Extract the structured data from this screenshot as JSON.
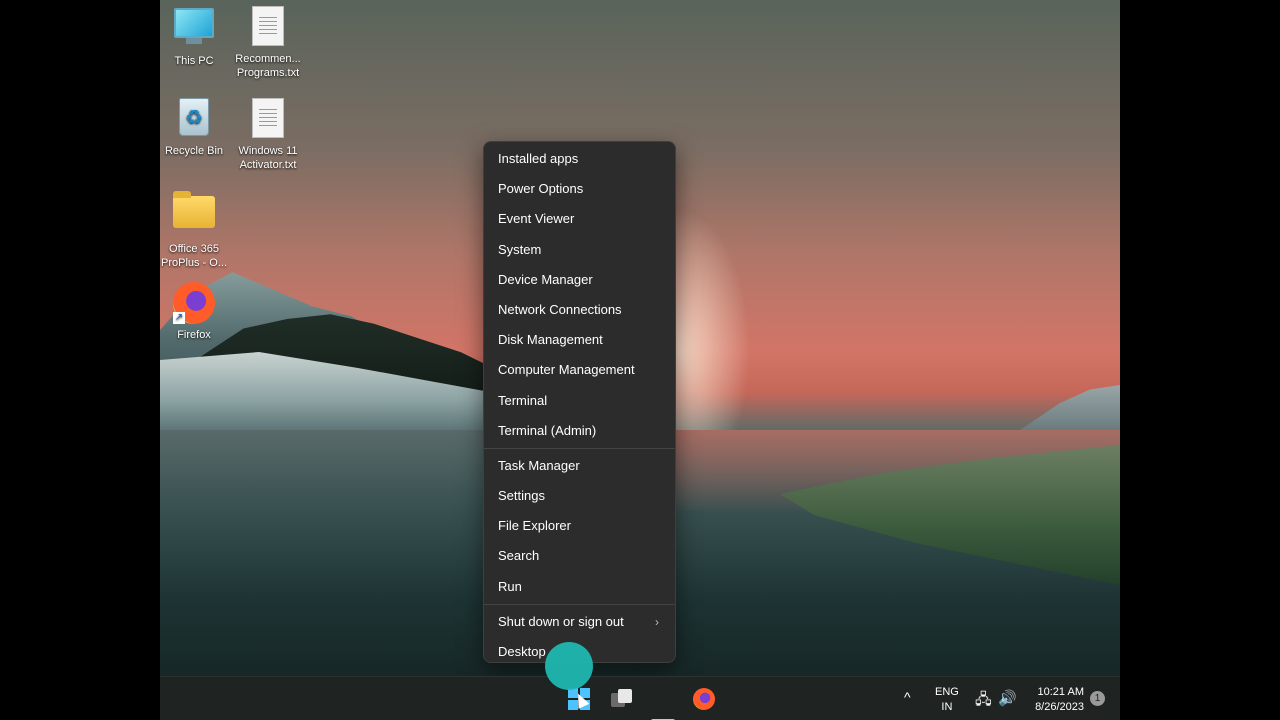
{
  "desktop": {
    "icons": [
      {
        "label": "This PC",
        "icon": "computer-icon"
      },
      {
        "label": "Recommen... Programs.txt",
        "icon": "text-file-icon"
      },
      {
        "label": "Recycle Bin",
        "icon": "recycle-bin-icon"
      },
      {
        "label": "Windows 11 Activator.txt",
        "icon": "text-file-icon"
      },
      {
        "label": "Office 365 ProPlus - O...",
        "icon": "folder-icon"
      },
      {
        "label": "Firefox",
        "icon": "firefox-icon"
      }
    ]
  },
  "context_menu": {
    "group1": [
      "Installed apps",
      "Power Options",
      "Event Viewer",
      "System",
      "Device Manager",
      "Network Connections",
      "Disk Management",
      "Computer Management",
      "Terminal",
      "Terminal (Admin)"
    ],
    "group2": [
      "Task Manager",
      "Settings",
      "File Explorer",
      "Search",
      "Run"
    ],
    "group3": [
      "Shut down or sign out",
      "Desktop"
    ],
    "submenu_glyph": "›"
  },
  "taskbar": {
    "pinned": [
      "start-icon",
      "task-view-icon",
      "file-explorer-icon",
      "firefox-icon"
    ],
    "tray": {
      "overflow_glyph": "^",
      "lang_line1": "ENG",
      "lang_line2": "IN",
      "network_glyph": "🖧",
      "volume_glyph": "🔊",
      "time": "10:21 AM",
      "date": "8/26/2023",
      "notification_count": "1"
    }
  }
}
